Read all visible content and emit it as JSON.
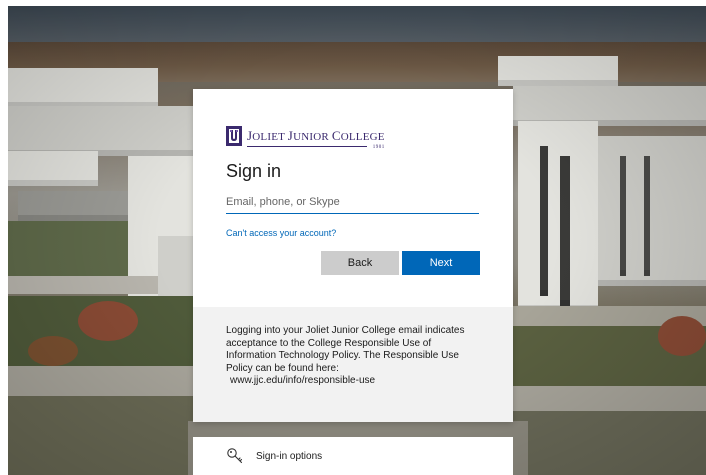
{
  "brand": {
    "logo_text_first_big": "J",
    "logo_text_first": "OLIET ",
    "logo_text_second_big": "J",
    "logo_text_second": "UNIOR ",
    "logo_text_third_big": "C",
    "logo_text_third": "OLLEGE",
    "logo_year": "1901",
    "accent_color": "#0067b8",
    "logo_color": "#3b2a6e"
  },
  "signin": {
    "title": "Sign in",
    "email_placeholder": "Email, phone, or Skype",
    "email_value": "",
    "cant_access_link": "Can't access your account?",
    "back_label": "Back",
    "next_label": "Next"
  },
  "notice": {
    "text": "Logging into your Joliet Junior College email indicates acceptance to the College Responsible Use of Information Technology Policy. The Responsible Use Policy can be found here:",
    "url": "www.jjc.edu/info/responsible-use"
  },
  "options": {
    "label": "Sign-in options",
    "icon": "key-icon"
  }
}
